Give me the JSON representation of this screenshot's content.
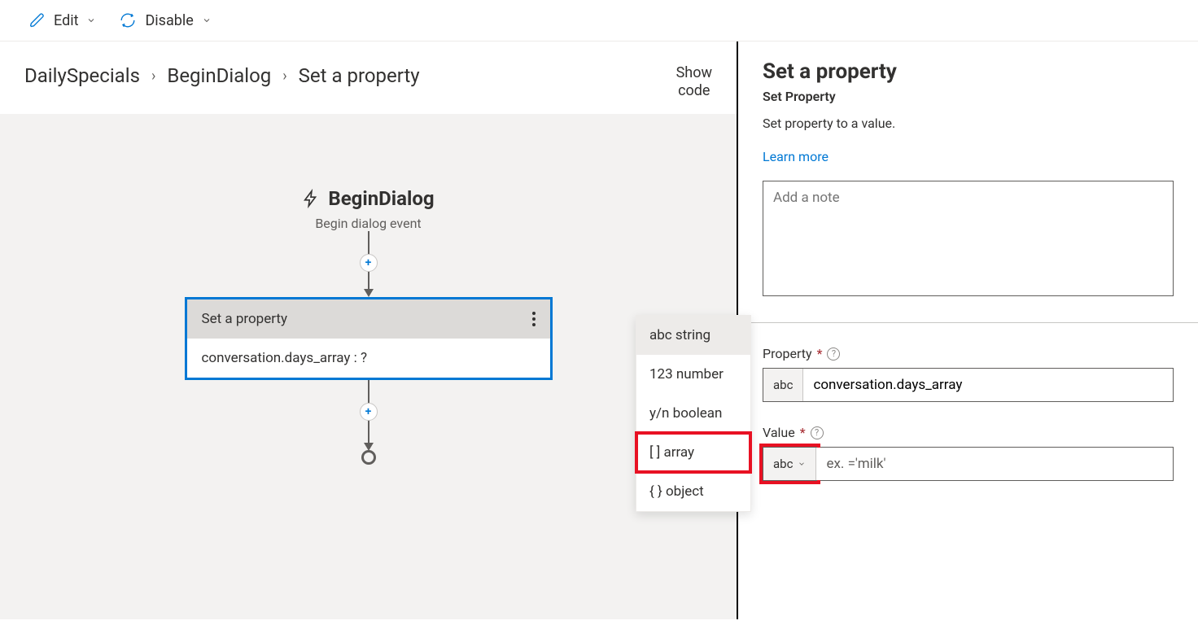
{
  "toolbar": {
    "edit_label": "Edit",
    "disable_label": "Disable"
  },
  "breadcrumb": {
    "items": [
      "DailySpecials",
      "BeginDialog",
      "Set a property"
    ]
  },
  "show_code": {
    "line1": "Show",
    "line2": "code"
  },
  "flow": {
    "begin_title": "BeginDialog",
    "begin_subtitle": "Begin dialog event",
    "node_title": "Set a property",
    "node_body": "conversation.days_array : ?"
  },
  "type_menu": {
    "items": [
      {
        "prefix": "abc",
        "label": "string"
      },
      {
        "prefix": "123",
        "label": "number"
      },
      {
        "prefix": "y/n",
        "label": "boolean"
      },
      {
        "prefix": "[ ]",
        "label": "array"
      },
      {
        "prefix": "{ }",
        "label": "object"
      }
    ]
  },
  "panel": {
    "title": "Set a property",
    "subtitle": "Set Property",
    "description": "Set property to a value.",
    "learn_more": "Learn more",
    "note_placeholder": "Add a note",
    "property": {
      "label": "Property",
      "chip": "abc",
      "value": "conversation.days_array"
    },
    "value": {
      "label": "Value",
      "chip": "abc",
      "placeholder": "ex. ='milk'"
    }
  }
}
